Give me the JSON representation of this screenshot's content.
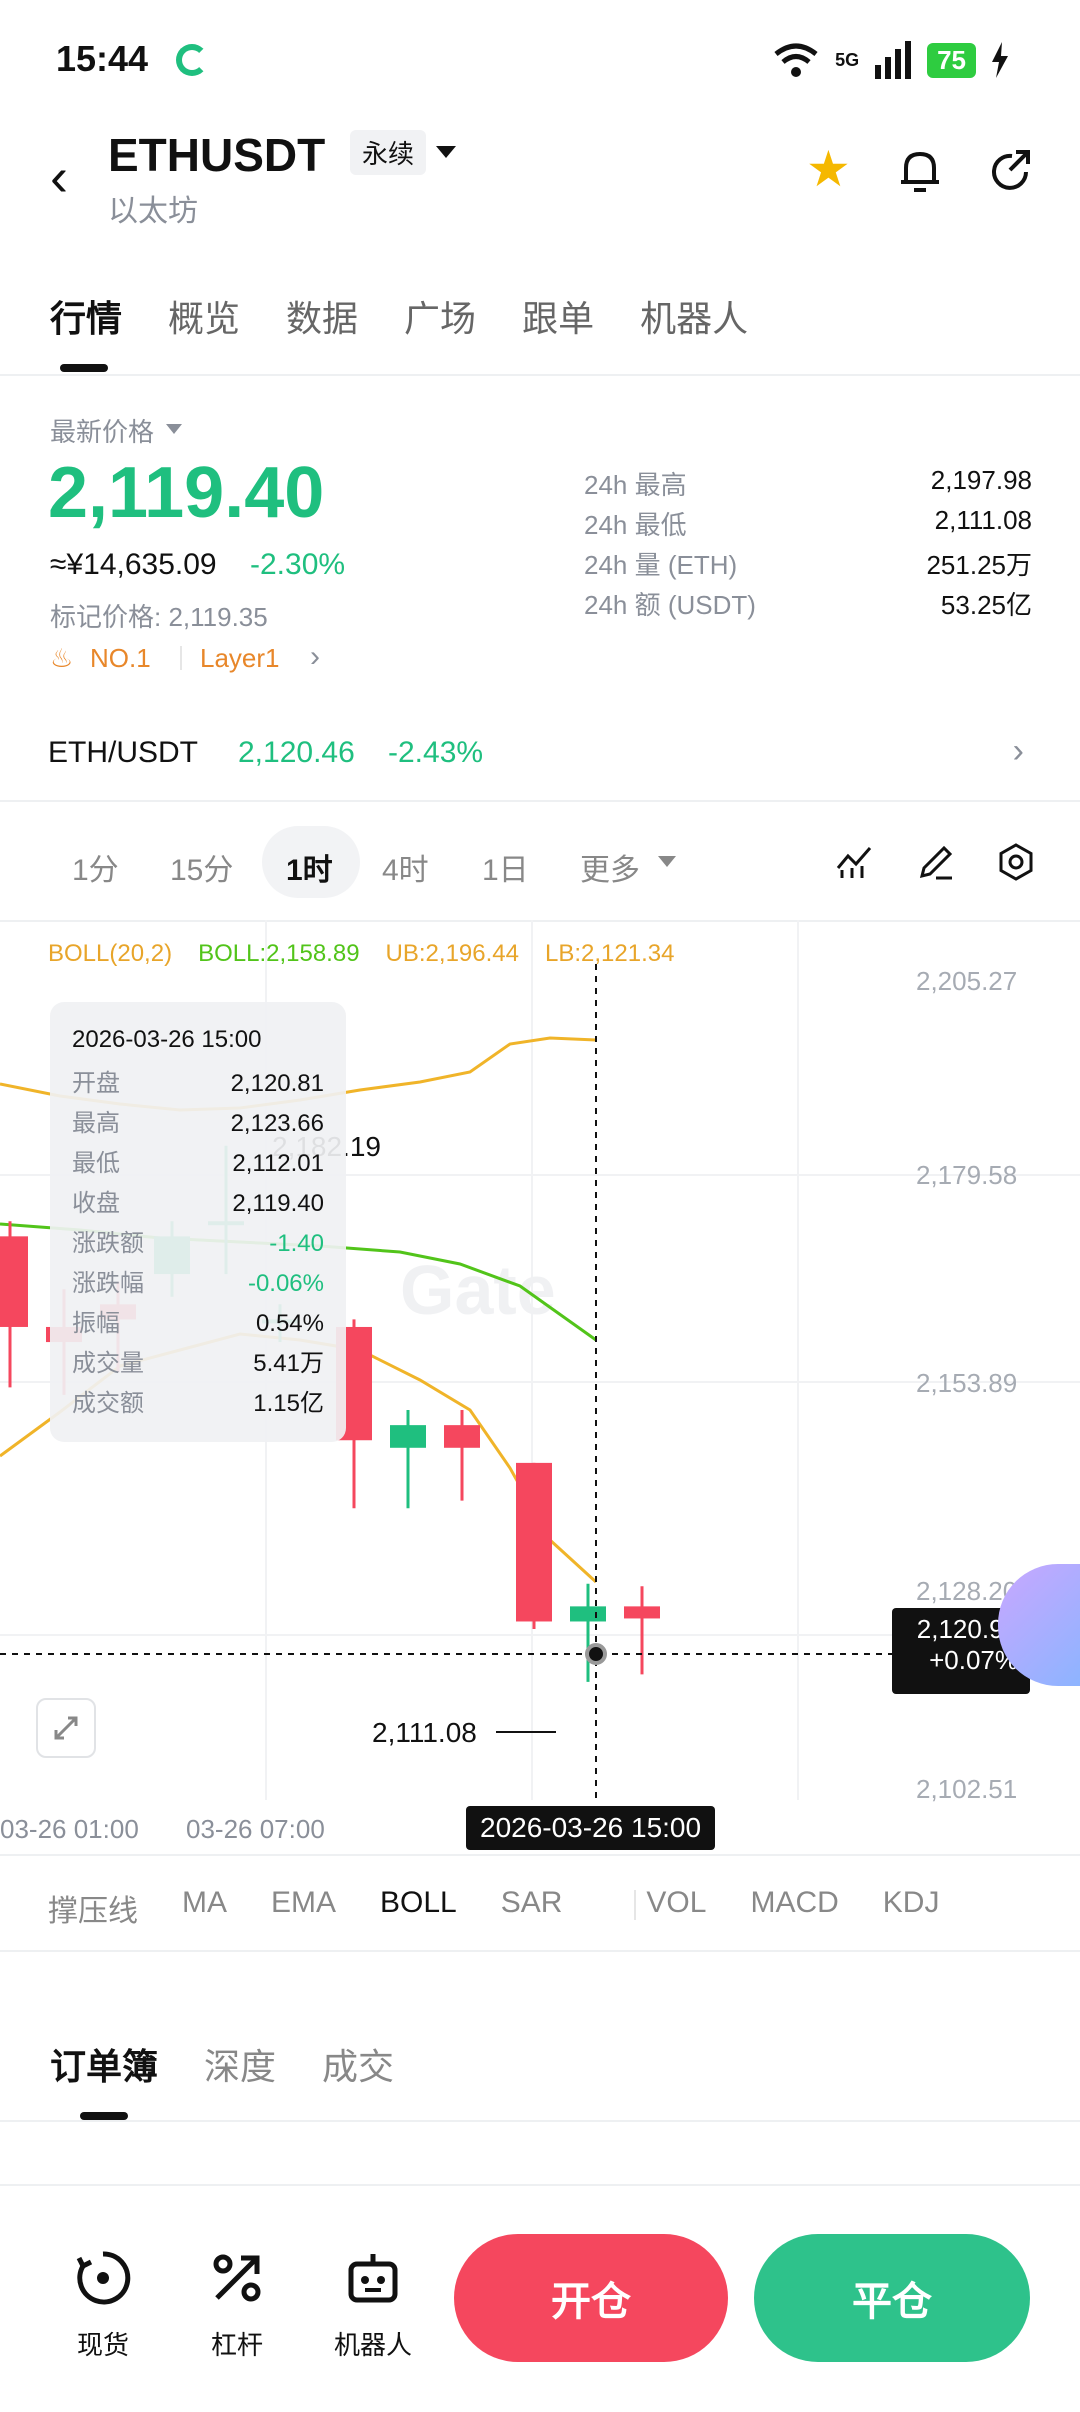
{
  "status": {
    "time": "15:44",
    "network": "5G",
    "battery": "75"
  },
  "header": {
    "symbol": "ETHUSDT",
    "contract_type": "永续",
    "name_cn": "以太坊",
    "icons": [
      "back-icon",
      "star-icon",
      "bell-icon",
      "share-icon"
    ]
  },
  "main_tabs": [
    "行情",
    "概览",
    "数据",
    "广场",
    "跟单",
    "机器人"
  ],
  "price": {
    "latest_label": "最新价格",
    "last": "2,119.40",
    "cny": "≈¥14,635.09",
    "pct": "-2.30%",
    "mark": "标记价格: 2,119.35",
    "rank": "NO.1",
    "sector": "Layer1"
  },
  "stats": [
    {
      "k": "24h  最高",
      "v": "2,197.98"
    },
    {
      "k": "24h  最低",
      "v": "2,111.08"
    },
    {
      "k": "24h  量 (ETH)",
      "v": "251.25万"
    },
    {
      "k": "24h  额 (USDT)",
      "v": "53.25亿"
    }
  ],
  "pair": {
    "name": "ETH/USDT",
    "price": "2,120.46",
    "pct": "-2.43%"
  },
  "intervals": [
    "1分",
    "15分",
    "1时",
    "4时",
    "1日",
    "更多"
  ],
  "active_interval": "1时",
  "boll_legend": {
    "name": "BOLL(20,2)",
    "boll": "BOLL:2,158.89",
    "ub": "UB:2,196.44",
    "lb": "LB:2,121.34"
  },
  "tooltip": {
    "time": "2026-03-26 15:00",
    "rows": [
      {
        "k": "开盘",
        "v": "2,120.81"
      },
      {
        "k": "最高",
        "v": "2,123.66"
      },
      {
        "k": "最低",
        "v": "2,112.01"
      },
      {
        "k": "收盘",
        "v": "2,119.40"
      },
      {
        "k": "涨跌额",
        "v": "-1.40"
      },
      {
        "k": "涨跌幅",
        "v": "-0.06%"
      },
      {
        "k": "振幅",
        "v": "0.54%"
      },
      {
        "k": "成交量",
        "v": "5.41万"
      },
      {
        "k": "成交额",
        "v": "1.15亿"
      }
    ]
  },
  "crosshair": {
    "price": "2,120.90",
    "pct": "+0.07%",
    "time": "2026-03-26 15:00"
  },
  "chart_data": {
    "type": "candlestick",
    "y_ticks": [
      "2,205.27",
      "2,179.58",
      "2,153.89",
      "2,128.20",
      "2,102.51"
    ],
    "x_ticks": [
      "03-26 01:00",
      "03-26 07:00"
    ],
    "high_label": "2,182.19",
    "low_label": "2,111.08",
    "watermark": "Gate",
    "candles": [
      {
        "o": 2170,
        "c": 2158,
        "h": 2172,
        "l": 2150
      },
      {
        "o": 2158,
        "c": 2156,
        "h": 2163,
        "l": 2149
      },
      {
        "o": 2161,
        "c": 2159,
        "h": 2164,
        "l": 2152
      },
      {
        "o": 2165,
        "c": 2170,
        "h": 2172,
        "l": 2162
      },
      {
        "o": 2172,
        "c": 2172,
        "h": 2182,
        "l": 2165
      },
      {
        "o": 2159,
        "c": 2159,
        "h": 2161,
        "l": 2156
      },
      {
        "o": 2158,
        "c": 2143,
        "h": 2159,
        "l": 2134
      },
      {
        "o": 2142,
        "c": 2145,
        "h": 2147,
        "l": 2134
      },
      {
        "o": 2145,
        "c": 2142,
        "h": 2147,
        "l": 2135
      },
      {
        "o": 2140,
        "c": 2119,
        "h": 2140,
        "l": 2118
      },
      {
        "o": 2119,
        "c": 2121,
        "h": 2124,
        "l": 2111
      },
      {
        "o": 2121,
        "c": 2119.4,
        "h": 2123.66,
        "l": 2112
      }
    ]
  },
  "indicators": [
    "撑压线",
    "MA",
    "EMA",
    "BOLL",
    "SAR",
    "VOL",
    "MACD",
    "KDJ"
  ],
  "active_indicator": "BOLL",
  "book_tabs": [
    "订单簿",
    "深度",
    "成交"
  ],
  "bottom_nav": [
    "现货",
    "杠杆",
    "机器人"
  ],
  "open_label": "开仓",
  "close_label": "平仓"
}
